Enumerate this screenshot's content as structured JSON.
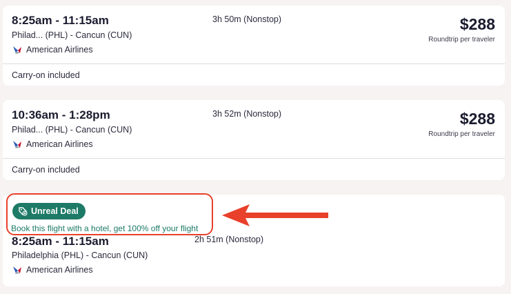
{
  "results": [
    {
      "times": "8:25am - 11:15am",
      "route": "Philad... (PHL) - Cancun (CUN)",
      "airline": "American Airlines",
      "duration": "3h 50m (Nonstop)",
      "price": "$288",
      "price_note": "Roundtrip per traveler",
      "carry_on": "Carry-on included"
    },
    {
      "times": "10:36am - 1:28pm",
      "route": "Philad... (PHL) - Cancun (CUN)",
      "airline": "American Airlines",
      "duration": "3h 52m (Nonstop)",
      "price": "$288",
      "price_note": "Roundtrip per traveler",
      "carry_on": "Carry-on included"
    },
    {
      "badge": "Unreal Deal",
      "deal_text": "Book this flight with a hotel, get 100% off your flight",
      "times": "8:25am - 11:15am",
      "route": "Philadelphia (PHL) - Cancun (CUN)",
      "airline": "American Airlines",
      "duration": "2h 51m (Nonstop)"
    }
  ],
  "colors": {
    "deal_green": "#1d7a66",
    "annotation_red": "#e8402a",
    "page_bg": "#f6f3f2"
  }
}
